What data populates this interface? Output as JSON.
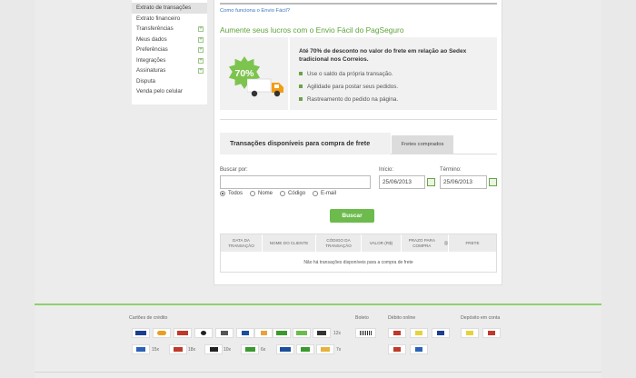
{
  "sidebar": {
    "items": [
      {
        "label": "Extrato de transações",
        "expandable": false
      },
      {
        "label": "Extrato financeiro",
        "expandable": false
      },
      {
        "label": "Transferências",
        "expandable": true
      },
      {
        "label": "Meus dados",
        "expandable": true
      },
      {
        "label": "Preferências",
        "expandable": true
      },
      {
        "label": "Integrações",
        "expandable": true
      },
      {
        "label": "Assinaturas",
        "expandable": true
      },
      {
        "label": "Disputa",
        "expandable": false
      },
      {
        "label": "Venda pelo celular",
        "expandable": false
      }
    ]
  },
  "main": {
    "how_link": "Como funciona o Envio Fácil?",
    "headline": "Aumente seus lucros com o Envio Fácil do PagSeguro",
    "promo": {
      "badge": "70%",
      "title": "Até 70% de desconto no valor do frete em relação ao Sedex tradicional nos Correios.",
      "bullets": [
        "Use o saldo da própria transação.",
        "Agilidade para postar seus pedidos.",
        "Rastreamento do pedido na página."
      ]
    },
    "tabs": {
      "active": "Transações disponíveis para compra de frete",
      "other": "Fretes comprados"
    },
    "search": {
      "label": "Buscar por:",
      "value": "",
      "start_label": "Início:",
      "start_value": "25/06/2013",
      "end_label": "Término:",
      "end_value": "25/06/2013",
      "options": [
        {
          "label": "Todos",
          "selected": true
        },
        {
          "label": "Nome",
          "selected": false
        },
        {
          "label": "Código",
          "selected": false
        },
        {
          "label": "E-mail",
          "selected": false
        }
      ],
      "button": "Buscar"
    },
    "table": {
      "headers": [
        "DATA DA TRANSAÇÃO",
        "NOME DO CLIENTE",
        "CÓDIGO DA TRANSAÇÃO",
        "VALOR (R$)",
        "PRAZO PARA COMPRA",
        "FRETE"
      ],
      "empty": "Não há transações disponíveis para a compra de frete"
    }
  },
  "footer": {
    "cards_label": "Cartões de crédito",
    "boleto_label": "Boleto",
    "debito_label": "Débito online",
    "deposito_label": "Depósito em conta",
    "installments": [
      "12x",
      "15x",
      "18x",
      "10x",
      "6x",
      "7x"
    ]
  },
  "colors": {
    "accent_green": "#6cbb4c",
    "link_blue": "#3b77c2",
    "footer_line": "#8fd06e"
  }
}
